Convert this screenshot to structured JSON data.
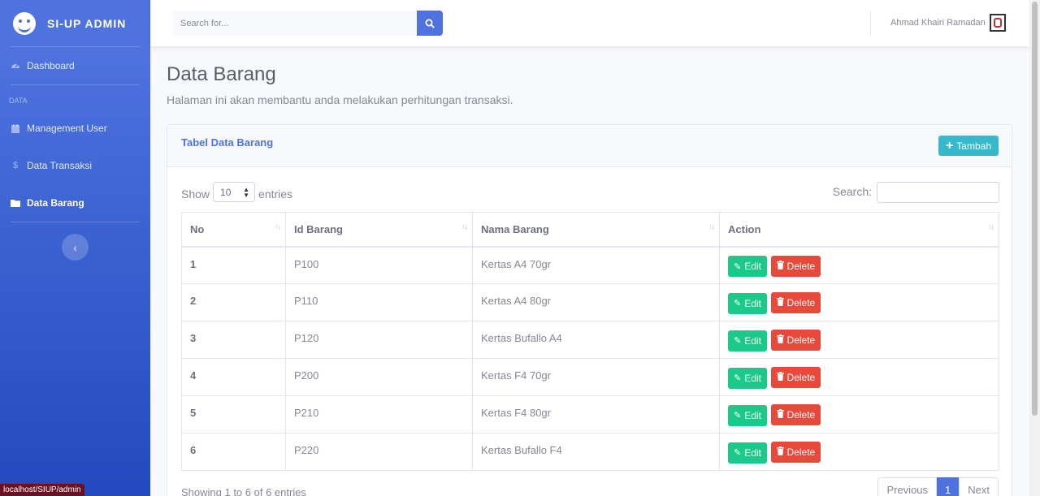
{
  "brand": {
    "name": "SI-UP ADMIN"
  },
  "sidebar": {
    "dashboard": "Dashboard",
    "heading": "Data",
    "items": [
      {
        "label": "Management User",
        "icon": "calendar-icon"
      },
      {
        "label": "Data Transaksi",
        "icon": "dollar-icon"
      },
      {
        "label": "Data Barang",
        "icon": "folder-icon"
      }
    ]
  },
  "status_url": "localhost/SIUP/admin",
  "topbar": {
    "search_placeholder": "Search for...",
    "user_name": "Ahmad Khairi Ramadan"
  },
  "page": {
    "title": "Data Barang",
    "subtitle": "Halaman ini akan membantu anda melakukan perhitungan transaksi."
  },
  "card": {
    "title": "Tabel Data Barang",
    "add_label": "Tambah",
    "show_label": "Show",
    "entries_value": "10",
    "entries_label": "entries",
    "search_label": "Search:",
    "columns": [
      "No",
      "Id Barang",
      "Nama Barang",
      "Action"
    ],
    "rows": [
      {
        "no": "1",
        "id": "P100",
        "nama": "Kertas A4 70gr"
      },
      {
        "no": "2",
        "id": "P110",
        "nama": "Kertas A4 80gr"
      },
      {
        "no": "3",
        "id": "P120",
        "nama": "Kertas Bufallo A4"
      },
      {
        "no": "4",
        "id": "P200",
        "nama": "Kertas F4 70gr"
      },
      {
        "no": "5",
        "id": "P210",
        "nama": "Kertas F4 80gr"
      },
      {
        "no": "6",
        "id": "P220",
        "nama": "Kertas Bufallo F4"
      }
    ],
    "edit_label": "Edit",
    "delete_label": "Delete",
    "info": "Showing 1 to 6 of 6 entries",
    "pagination": {
      "prev": "Previous",
      "current": "1",
      "next": "Next"
    }
  },
  "colors": {
    "primary": "#4e73df",
    "success": "#1cc88a",
    "danger": "#e74a3b",
    "info": "#36b9cc"
  }
}
